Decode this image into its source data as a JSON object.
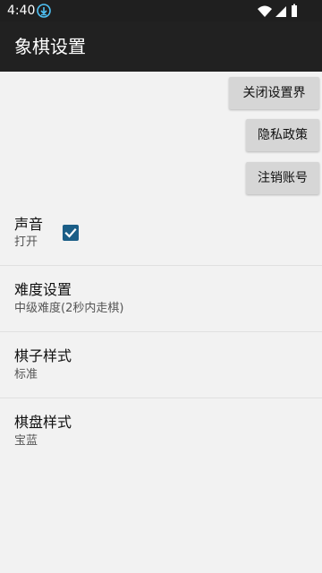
{
  "status": {
    "time": "4:40",
    "icons": [
      "download-icon",
      "wifi-icon",
      "signal-icon",
      "battery-icon"
    ]
  },
  "appbar": {
    "title": "象棋设置"
  },
  "buttons": {
    "close": "关闭设置界面",
    "privacy": "隐私政策",
    "cancel_account": "注销账号"
  },
  "prefs": {
    "sound": {
      "title": "声音",
      "summary": "打开",
      "checked": true
    },
    "difficulty": {
      "title": "难度设置",
      "summary": "中级难度(2秒内走棋)"
    },
    "piece_style": {
      "title": "棋子样式",
      "summary": "标准"
    },
    "board_style": {
      "title": "棋盘样式",
      "summary": "宝蓝"
    }
  },
  "colors": {
    "appbar": "#212121",
    "status_bar": "#1f1f1f",
    "background": "#f2f2f2",
    "checkbox_accent": "#1b5e87",
    "download_icon_accent": "#4fc3f7"
  }
}
